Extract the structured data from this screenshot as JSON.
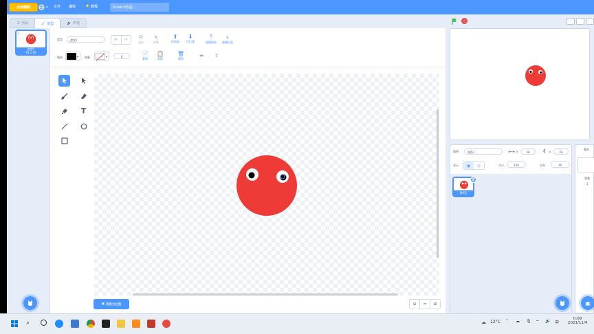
{
  "topbar": {
    "logo_text": "点点编程",
    "menu_file": "文件",
    "menu_edit": "编辑",
    "menu_tutorial": "教程",
    "project_title": "Scratch作品"
  },
  "tabs": {
    "code": "代码",
    "costumes": "造型",
    "sounds": "声音"
  },
  "costume_list": [
    {
      "number": "1",
      "name": "造型1",
      "size": "95 x 95"
    }
  ],
  "paint_editor": {
    "costume_label": "造型",
    "costume_name": "造型1",
    "group_label": "组合",
    "ungroup_label": "拆散",
    "forward_label": "往前放",
    "backward_label": "往后放",
    "front_label": "放最前面",
    "back_label": "放最后面",
    "fill_label": "填充",
    "outline_label": "轮廓",
    "outline_width": "0",
    "copy_label": "复制",
    "paste_label": "粘贴",
    "delete_label": "删除",
    "convert_button": "转换为位图",
    "zoom_reset": "="
  },
  "sprite_info": {
    "sprite_label": "角色",
    "sprite_name": "角色1",
    "x_label": "x",
    "x_value": "38",
    "y_label": "y",
    "y_value": "28",
    "show_label": "显示",
    "size_label": "大小",
    "size_value": "100",
    "direction_label": "方向",
    "direction_value": "90",
    "sprite_thumb_name": "角色1"
  },
  "stage_panel": {
    "title": "舞台",
    "backdrops_label": "背景",
    "backdrops_count": "1"
  },
  "taskbar": {
    "temperature": "12°C",
    "time": "0:09",
    "date": "2021/11/4"
  },
  "colors": {
    "accent": "#4c97ff",
    "sprite_red": "#ee3b37",
    "green_flag": "#4cbf56",
    "stop": "#ec5959",
    "logo": "#ffbf00"
  }
}
